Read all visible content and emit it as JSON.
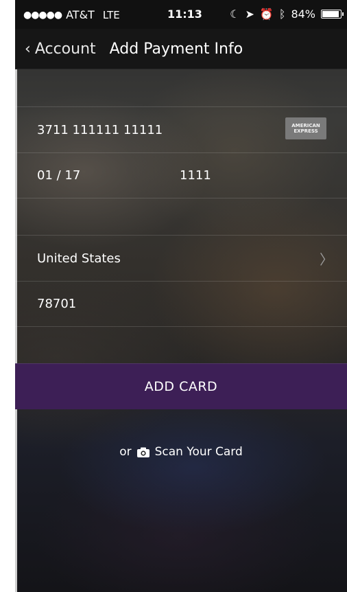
{
  "status_bar": {
    "signal": "●●●●●",
    "carrier": "AT&T",
    "network": "LTE",
    "time": "11:13",
    "battery": "84%",
    "battery_level": 0.84
  },
  "nav": {
    "back_label": "Account",
    "title": "Add Payment Info"
  },
  "card": {
    "number": "3711 111111 11111",
    "brand_line1": "AMERICAN",
    "brand_line2": "EXPRESS",
    "expiry": "01 / 17",
    "cvv": "1111"
  },
  "billing": {
    "country": "United States",
    "zip": "78701"
  },
  "actions": {
    "add_card_label": "ADD CARD",
    "scan_prefix": "or",
    "scan_label": "Scan Your Card"
  },
  "colors": {
    "accent": "#3d1f56"
  }
}
